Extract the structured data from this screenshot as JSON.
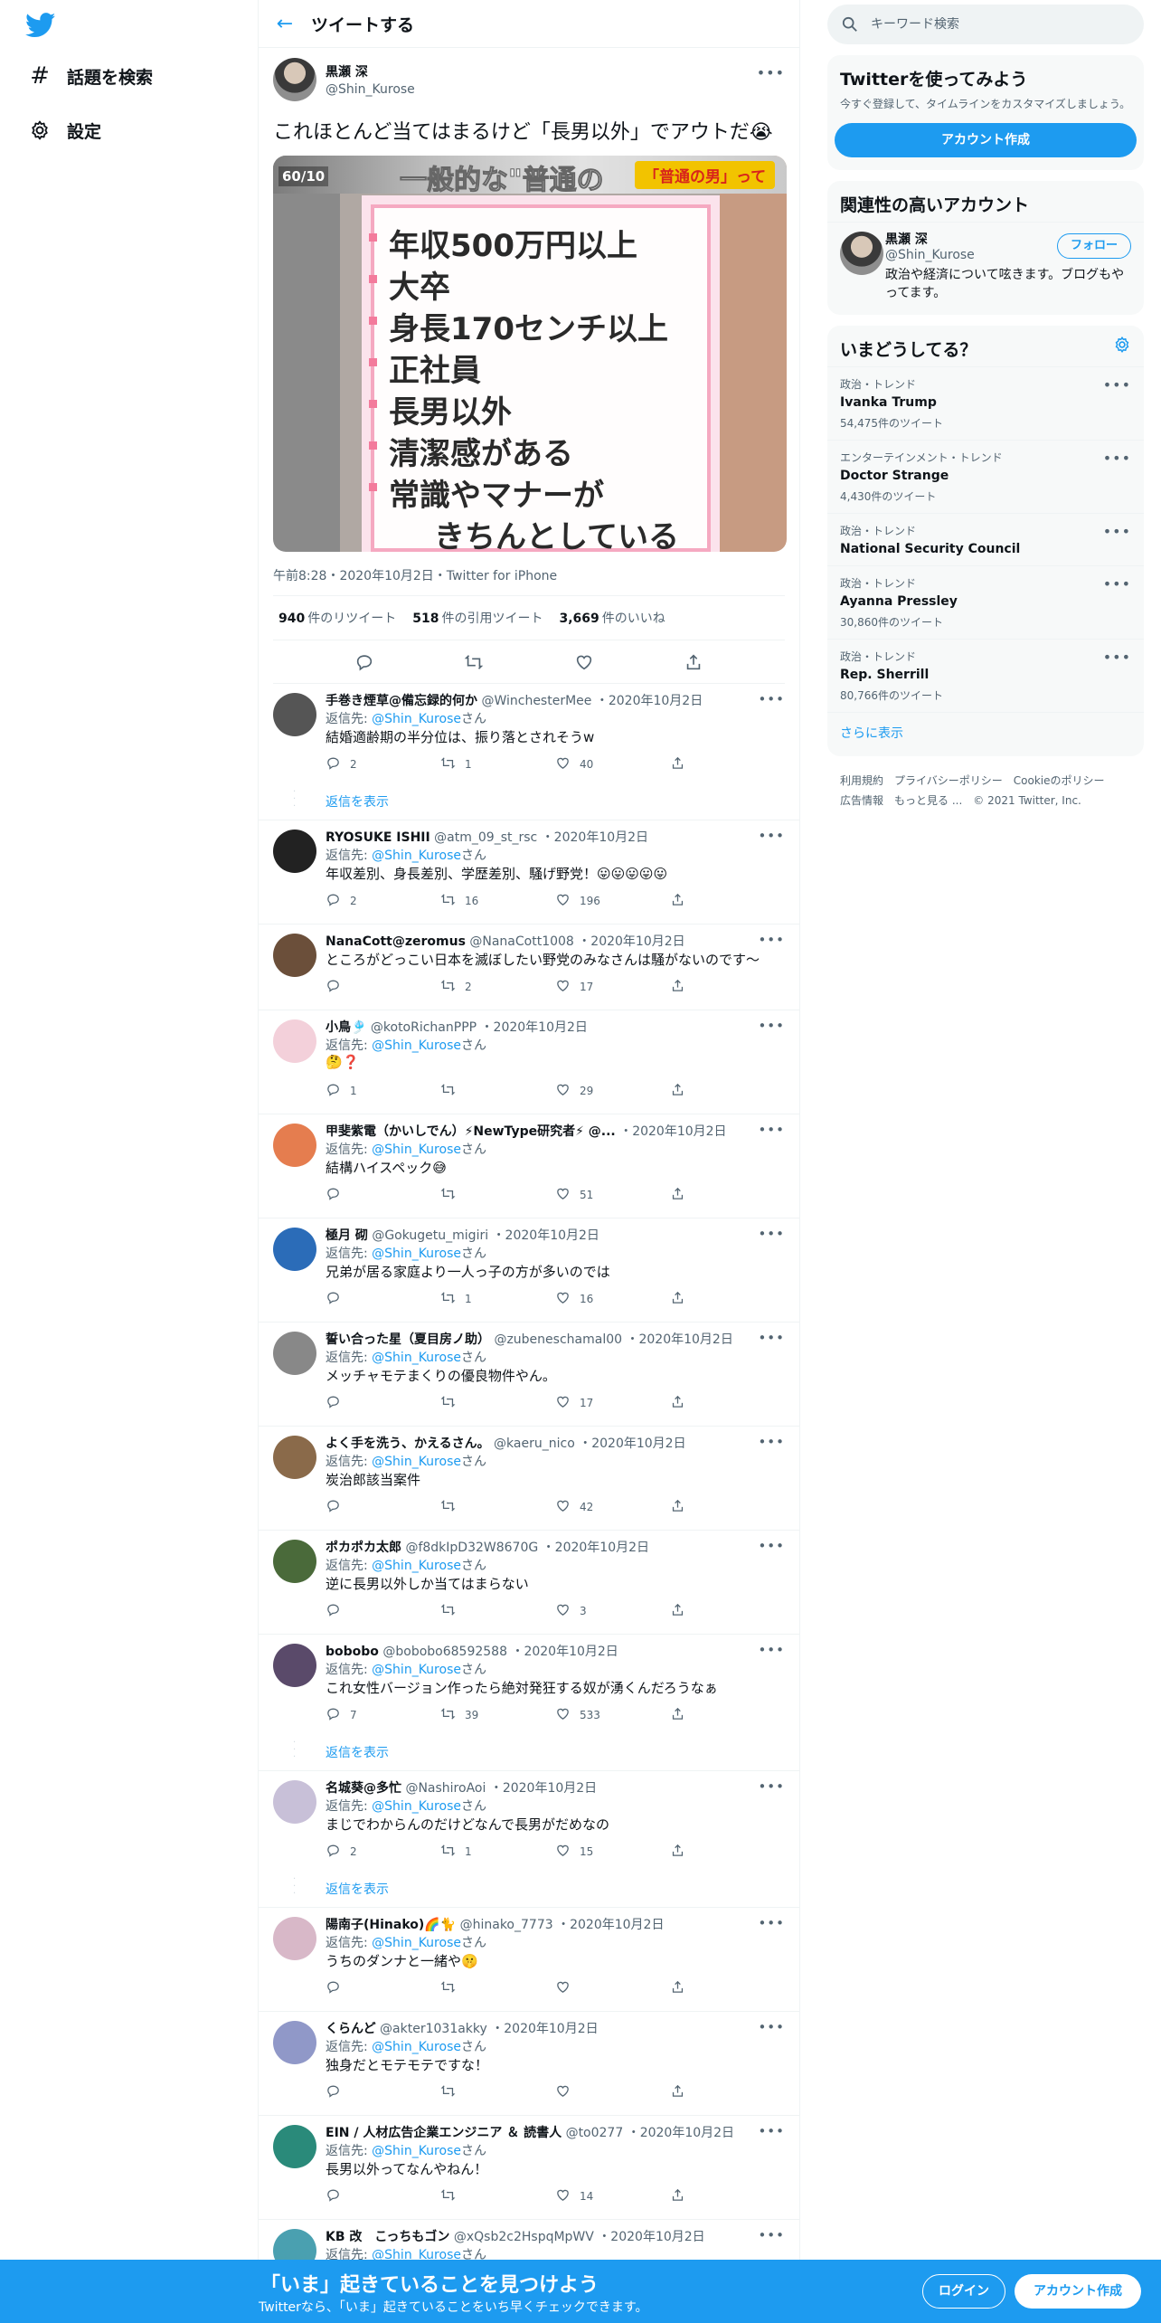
{
  "nav": {
    "logo_icon": "twitter-bird-icon",
    "items": [
      {
        "icon": "hashtag-icon",
        "label": "話題を検索"
      },
      {
        "icon": "gear-icon",
        "label": "設定"
      }
    ]
  },
  "header": {
    "title": "ツイートする",
    "back_icon": "arrow-left-icon"
  },
  "main_tweet": {
    "name": "黒瀬 深",
    "handle": "@Shin_Kurose",
    "text": "これほとんど当てはまるけど「長男以外」でアウトだ😭",
    "image": {
      "banner": "一般的な\"普通の",
      "banner_tag": "「普通の男」って",
      "corner": "60/10",
      "lines": [
        "年収500万円以上",
        "大卒",
        "身長170センチ以上",
        "正社員",
        "長男以外",
        "清潔感がある",
        "常識やマナーが",
        "きちんとしている"
      ]
    },
    "meta": "午前8:28・2020年10月2日・Twitter for iPhone",
    "stats": {
      "retweets_num": "940",
      "retweets_label": "件のリツイート",
      "quotes_num": "518",
      "quotes_label": "件の引用ツイート",
      "likes_num": "3,669",
      "likes_label": "件のいいね"
    }
  },
  "reply_to_label": "返信先:",
  "reply_suffix": "さん",
  "show_replies_label": "返信を表示",
  "replies": [
    {
      "name": "手巻き煙草@備忘録的何か",
      "handle": "@WinchesterMee",
      "date": "・2020年10月2日",
      "to": "@Shin_Kurose",
      "text": "結婚適齢期の半分位は、振り落とされそうw",
      "reply": "2",
      "rt": "1",
      "like": "40",
      "show_replies": true,
      "avatar": "#555"
    },
    {
      "name": "RYOSUKE ISHII",
      "handle": "@atm_09_st_rsc",
      "date": "・2020年10月2日",
      "to": "@Shin_Kurose",
      "text": "年収差別、身長差別、学歴差別、騒げ野党！😛😛😛😛😛",
      "reply": "2",
      "rt": "16",
      "like": "196",
      "show_replies": false,
      "thread": true,
      "avatar": "#222"
    },
    {
      "name": "NanaCott@zeromus",
      "handle": "@NanaCott1008",
      "date": "・2020年10月2日",
      "to": "",
      "text": "ところがどっこい日本を滅ぼしたい野党のみなさんは騒がないのです～",
      "reply": "",
      "rt": "2",
      "like": "17",
      "show_replies": false,
      "avatar": "#6b4f3a"
    },
    {
      "name": "小鳥🎐",
      "handle": "@kotoRichanPPP",
      "date": "・2020年10月2日",
      "to": "@Shin_Kurose",
      "text": "🤔❓",
      "reply": "1",
      "rt": "",
      "like": "29",
      "show_replies": false,
      "avatar": "#f3d0da"
    },
    {
      "name": "甲斐紫電（かいしでん）⚡NewType研究者⚡ @...",
      "handle": "",
      "date": "・2020年10月2日",
      "to": "@Shin_Kurose",
      "text": "結構ハイスペック😅",
      "reply": "",
      "rt": "",
      "like": "51",
      "show_replies": false,
      "avatar": "#e57d4f"
    },
    {
      "name": "極月 砌",
      "handle": "@Gokugetu_migiri",
      "date": "・2020年10月2日",
      "to": "@Shin_Kurose",
      "text": "兄弟が居る家庭より一人っ子の方が多いのでは",
      "reply": "",
      "rt": "1",
      "like": "16",
      "show_replies": false,
      "avatar": "#2b6cb8"
    },
    {
      "name": "誓い合った星（夏目房ノ助）",
      "handle": "@zubeneschamal00",
      "date": "・2020年10月2日",
      "to": "@Shin_Kurose",
      "text": "メッチャモテまくりの優良物件やん。",
      "reply": "",
      "rt": "",
      "like": "17",
      "show_replies": false,
      "avatar": "#888"
    },
    {
      "name": "よく手を洗う、かえるさん。",
      "handle": "@kaeru_nico",
      "date": "・2020年10月2日",
      "to": "@Shin_Kurose",
      "text": "炭治郎該当案件",
      "reply": "",
      "rt": "",
      "like": "42",
      "show_replies": false,
      "avatar": "#8a6a4a"
    },
    {
      "name": "ポカポカ太郎",
      "handle": "@f8dkIpD32W8670G",
      "date": "・2020年10月2日",
      "to": "@Shin_Kurose",
      "text": "逆に長男以外しか当てはまらない",
      "reply": "",
      "rt": "",
      "like": "3",
      "show_replies": false,
      "avatar": "#4a6a3a"
    },
    {
      "name": "bobobo",
      "handle": "@bobobo68592588",
      "date": "・2020年10月2日",
      "to": "@Shin_Kurose",
      "text": "これ女性バージョン作ったら絶対発狂する奴が湧くんだろうなぁ",
      "reply": "7",
      "rt": "39",
      "like": "533",
      "show_replies": true,
      "avatar": "#5a4a6a"
    },
    {
      "name": "名城葵@多忙",
      "handle": "@NashiroAoi",
      "date": "・2020年10月2日",
      "to": "@Shin_Kurose",
      "text": "まじでわからんのだけどなんで長男がだめなの",
      "reply": "2",
      "rt": "1",
      "like": "15",
      "show_replies": true,
      "avatar": "#c8c0d8"
    },
    {
      "name": "陽南子(Hinako)🌈🐈",
      "handle": "@hinako_7773",
      "date": "・2020年10月2日",
      "to": "@Shin_Kurose",
      "text": "うちのダンナと一緒や🤫",
      "reply": "",
      "rt": "",
      "like": "",
      "show_replies": false,
      "avatar": "#d8b8c8"
    },
    {
      "name": "くらんど",
      "handle": "@akter1031akky",
      "date": "・2020年10月2日",
      "to": "@Shin_Kurose",
      "text": "独身だとモテモテですな！",
      "reply": "",
      "rt": "",
      "like": "",
      "show_replies": false,
      "avatar": "#9098c8"
    },
    {
      "name": "EIN / 人材広告企業エンジニア ＆ 読書人",
      "handle": "@to0277",
      "date": "・2020年10月2日",
      "to": "@Shin_Kurose",
      "text": "長男以外ってなんやねん！",
      "reply": "",
      "rt": "",
      "like": "14",
      "show_replies": false,
      "avatar": "#2a8a7a"
    },
    {
      "name": "KB 改　こっちもゴン",
      "handle": "@xQsb2c2HspqMpWV",
      "date": "・2020年10月2日",
      "to": "@Shin_Kurose",
      "text": "",
      "reply": "",
      "rt": "",
      "like": "",
      "show_replies": false,
      "avatar": "#4aa0b0"
    }
  ],
  "right": {
    "search_placeholder": "キーワード検索",
    "join": {
      "title": "Twitterを使ってみよう",
      "desc": "今すぐ登録して、タイムラインをカスタマイズしましょう。",
      "button": "アカウント作成"
    },
    "related": {
      "title": "関連性の高いアカウント",
      "name": "黒瀬 深",
      "handle": "@Shin_Kurose",
      "follow": "フォロー",
      "bio": "政治や経済について呟きます。ブログもやってます。"
    },
    "trends": {
      "title": "いまどうしてる？",
      "items": [
        {
          "cat": "政治・トレンド",
          "name": "Ivanka Trump",
          "count": "54,475件のツイート"
        },
        {
          "cat": "エンターテインメント・トレンド",
          "name": "Doctor Strange",
          "count": "4,430件のツイート"
        },
        {
          "cat": "政治・トレンド",
          "name": "National Security Council",
          "count": ""
        },
        {
          "cat": "政治・トレンド",
          "name": "Ayanna Pressley",
          "count": "30,860件のツイート"
        },
        {
          "cat": "政治・トレンド",
          "name": "Rep. Sherrill",
          "count": "80,766件のツイート"
        }
      ],
      "show_more": "さらに表示"
    },
    "footer": {
      "links": [
        "利用規約",
        "プライバシーポリシー",
        "Cookieのポリシー",
        "広告情報",
        "もっと見る ..."
      ],
      "copyright": "© 2021 Twitter, Inc."
    }
  },
  "bottom": {
    "title": "「いま」起きていることを見つけよう",
    "sub": "Twitterなら、「いま」起きていることをいち早くチェックできます。",
    "login": "ログイン",
    "signup": "アカウント作成"
  },
  "colors": {
    "accent": "#1d9bf0",
    "text": "#0f1419",
    "muted": "#536471",
    "border": "#eff3f4"
  }
}
